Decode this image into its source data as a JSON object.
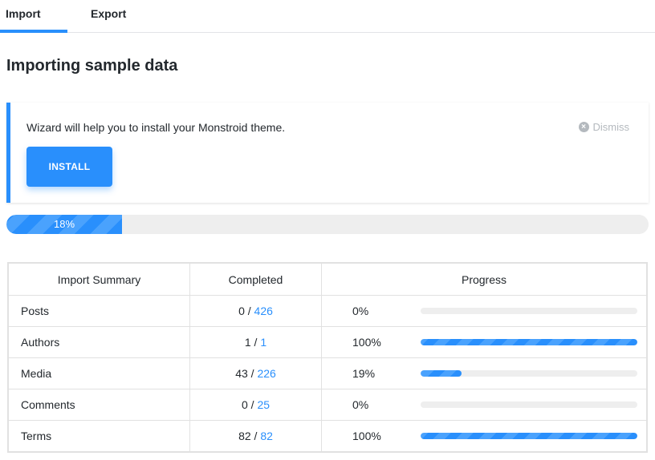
{
  "tabs": [
    {
      "label": "Import",
      "active": true
    },
    {
      "label": "Export",
      "active": false
    }
  ],
  "page_title": "Importing sample data",
  "notice": {
    "text": "Wizard will help you to install your Monstroid theme.",
    "dismiss_label": "Dismiss",
    "dismiss_icon": "close-circle-icon",
    "install_label": "INSTALL"
  },
  "progress": {
    "value": 18,
    "label": "18%"
  },
  "table": {
    "headers": [
      "Import Summary",
      "Completed",
      "Progress"
    ],
    "rows": [
      {
        "name": "Posts",
        "done": "0",
        "total": "426",
        "percent": "0%",
        "value": 0
      },
      {
        "name": "Authors",
        "done": "1",
        "total": "1",
        "percent": "100%",
        "value": 100
      },
      {
        "name": "Media",
        "done": "43",
        "total": "226",
        "percent": "19%",
        "value": 19
      },
      {
        "name": "Comments",
        "done": "0",
        "total": "25",
        "percent": "0%",
        "value": 0
      },
      {
        "name": "Terms",
        "done": "82",
        "total": "82",
        "percent": "100%",
        "value": 100
      }
    ]
  },
  "colors": {
    "accent": "#298ffc",
    "track": "#eeeeee",
    "text": "#23282d",
    "muted": "#b4b9be"
  }
}
